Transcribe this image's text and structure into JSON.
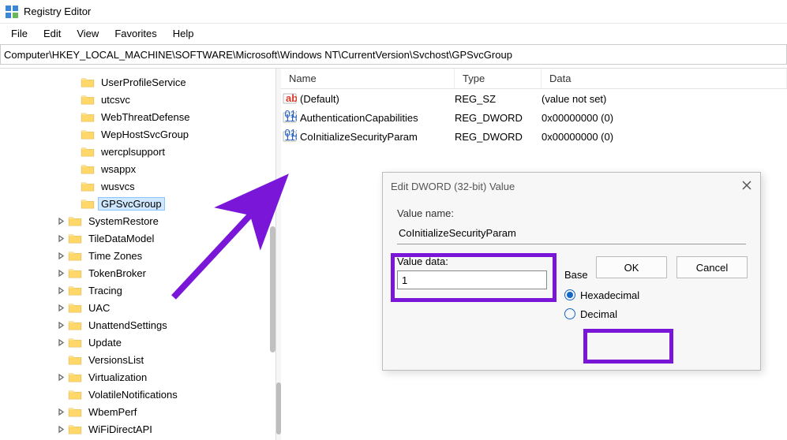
{
  "app": {
    "title": "Registry Editor"
  },
  "menu": [
    "File",
    "Edit",
    "View",
    "Favorites",
    "Help"
  ],
  "address": "Computer\\HKEY_LOCAL_MACHINE\\SOFTWARE\\Microsoft\\Windows NT\\CurrentVersion\\Svchost\\GPSvcGroup",
  "tree": {
    "items": [
      {
        "label": "UserProfileService",
        "level": 1,
        "exp": ""
      },
      {
        "label": "utcsvc",
        "level": 1,
        "exp": ""
      },
      {
        "label": "WebThreatDefense",
        "level": 1,
        "exp": ""
      },
      {
        "label": "WepHostSvcGroup",
        "level": 1,
        "exp": ""
      },
      {
        "label": "wercplsupport",
        "level": 1,
        "exp": ""
      },
      {
        "label": "wsappx",
        "level": 1,
        "exp": ""
      },
      {
        "label": "wusvcs",
        "level": 1,
        "exp": ""
      },
      {
        "label": "GPSvcGroup",
        "level": 1,
        "exp": "",
        "selected": true
      },
      {
        "label": "SystemRestore",
        "level": 2,
        "exp": ">"
      },
      {
        "label": "TileDataModel",
        "level": 2,
        "exp": ">"
      },
      {
        "label": "Time Zones",
        "level": 2,
        "exp": ">"
      },
      {
        "label": "TokenBroker",
        "level": 2,
        "exp": ">"
      },
      {
        "label": "Tracing",
        "level": 2,
        "exp": ">"
      },
      {
        "label": "UAC",
        "level": 2,
        "exp": ">"
      },
      {
        "label": "UnattendSettings",
        "level": 2,
        "exp": ">"
      },
      {
        "label": "Update",
        "level": 2,
        "exp": ">"
      },
      {
        "label": "VersionsList",
        "level": 2,
        "exp": ""
      },
      {
        "label": "Virtualization",
        "level": 2,
        "exp": ">"
      },
      {
        "label": "VolatileNotifications",
        "level": 2,
        "exp": ""
      },
      {
        "label": "WbemPerf",
        "level": 2,
        "exp": ">"
      },
      {
        "label": "WiFiDirectAPI",
        "level": 2,
        "exp": ">"
      }
    ]
  },
  "columns": {
    "name": "Name",
    "type": "Type",
    "data": "Data"
  },
  "values": [
    {
      "icon": "string",
      "name": "(Default)",
      "type": "REG_SZ",
      "data": "(value not set)"
    },
    {
      "icon": "binary",
      "name": "AuthenticationCapabilities",
      "type": "REG_DWORD",
      "data": "0x00000000 (0)"
    },
    {
      "icon": "binary",
      "name": "CoInitializeSecurityParam",
      "type": "REG_DWORD",
      "data": "0x00000000 (0)"
    }
  ],
  "dialog": {
    "title": "Edit DWORD (32-bit) Value",
    "vname_label": "Value name:",
    "vname_value": "CoInitializeSecurityParam",
    "vdata_label": "Value data:",
    "vdata_value": "1",
    "base_label": "Base",
    "hex_label": "Hexadecimal",
    "dec_label": "Decimal",
    "ok_label": "OK",
    "cancel_label": "Cancel",
    "base_selected": "hex"
  },
  "annotation": {
    "color": "#7a16d8"
  }
}
